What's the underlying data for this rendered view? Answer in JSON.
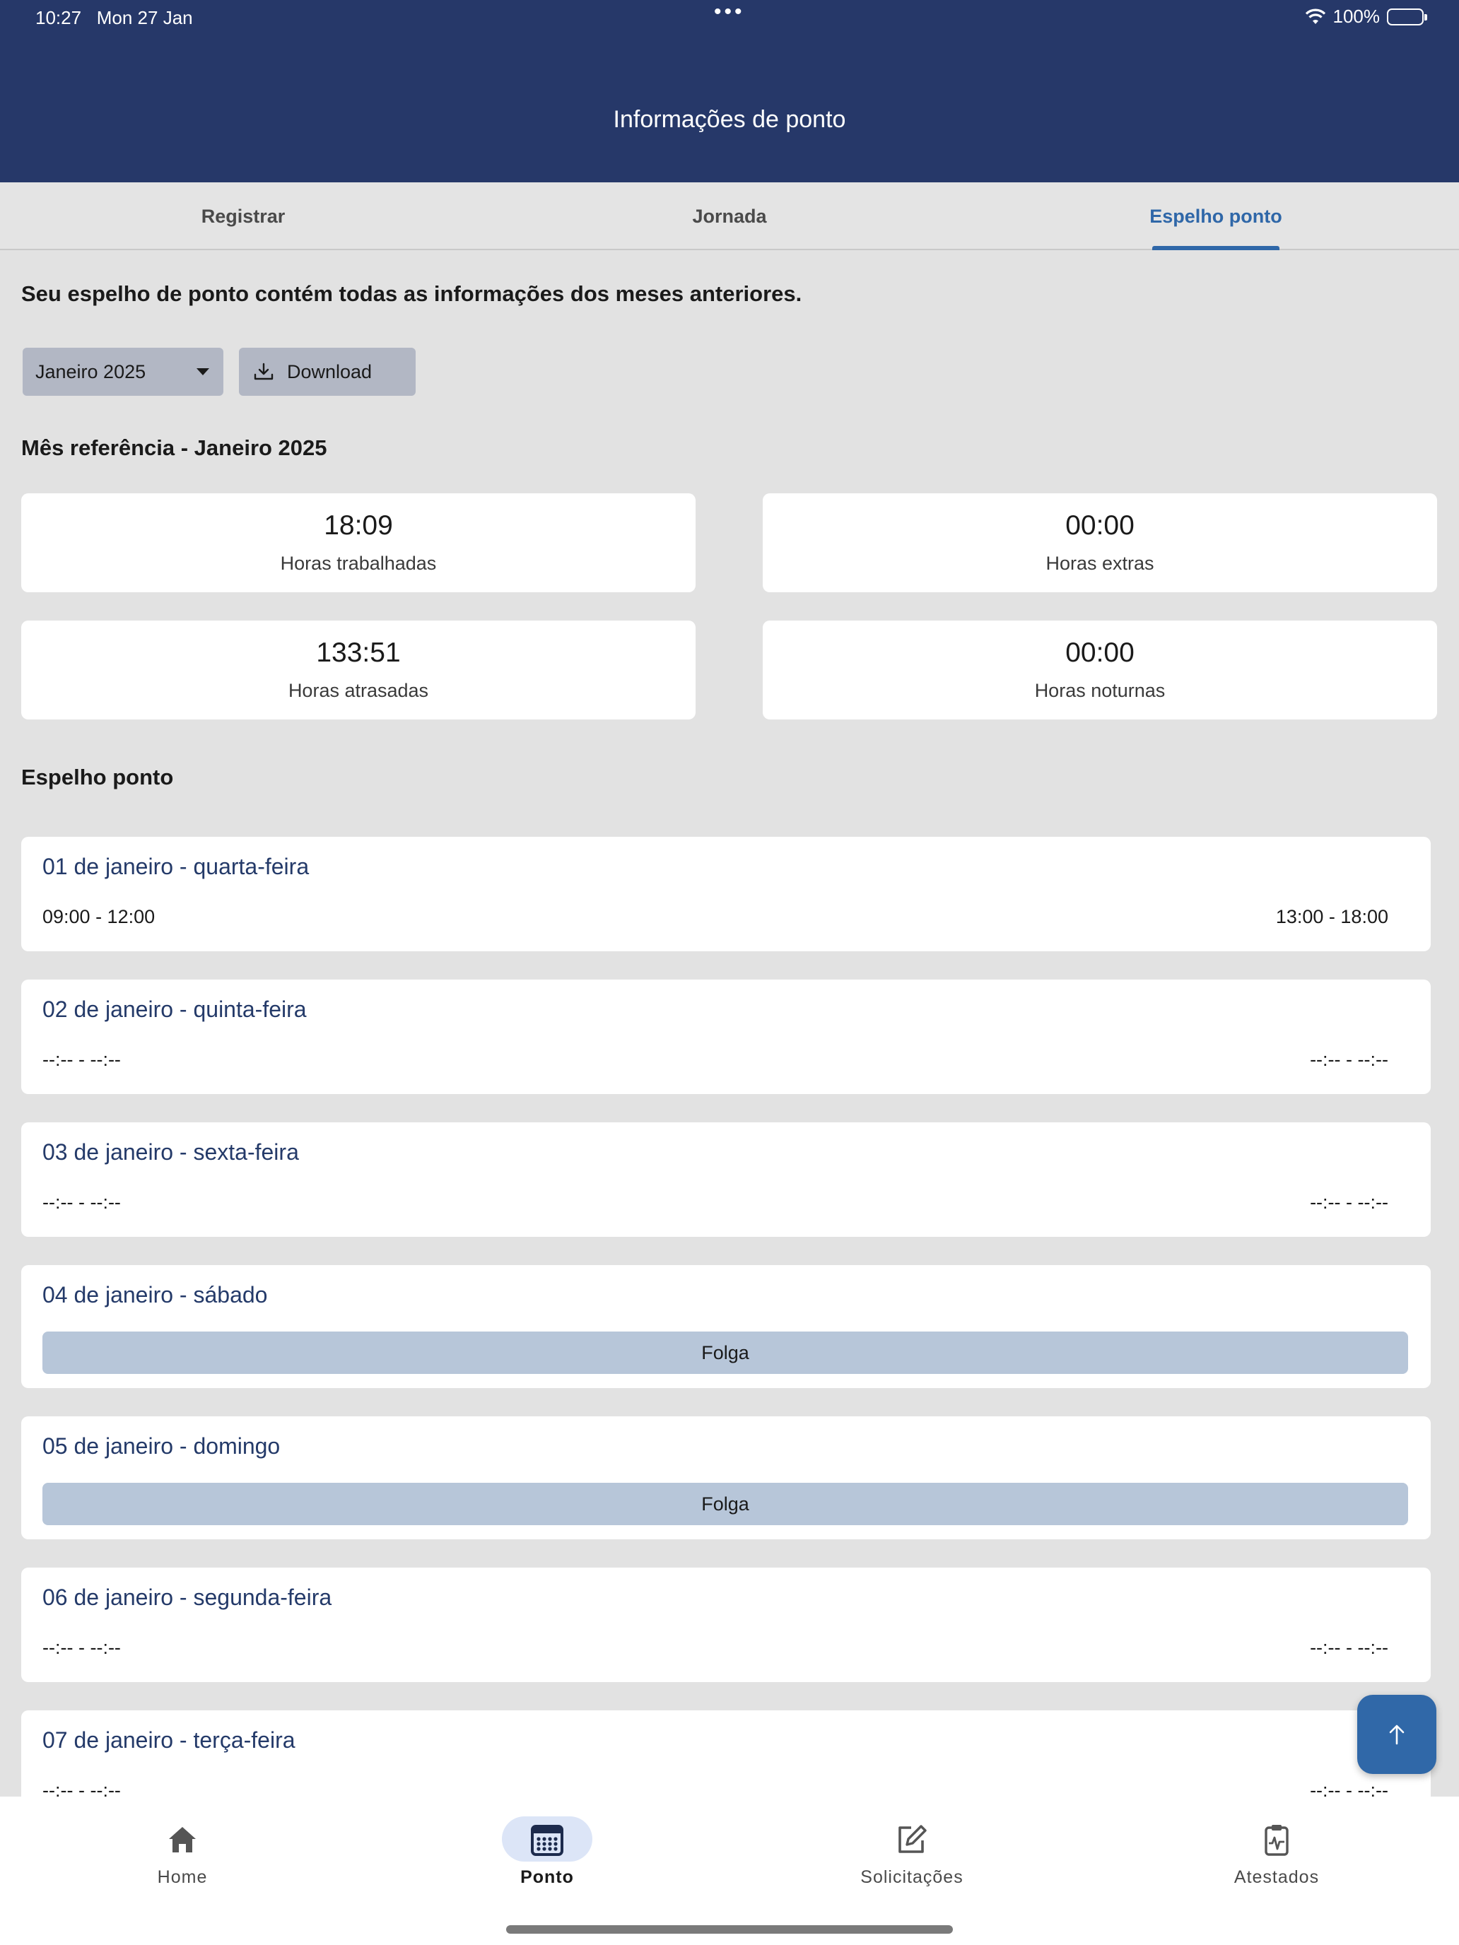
{
  "status_bar": {
    "time": "10:27",
    "date": "Mon 27 Jan",
    "dots": "•••",
    "battery": "100%"
  },
  "header": {
    "title": "Informações de ponto"
  },
  "tabs": [
    {
      "label": "Registrar"
    },
    {
      "label": "Jornada"
    },
    {
      "label": "Espelho ponto"
    }
  ],
  "intro": "Seu espelho de ponto contém todas as informações dos meses anteriores.",
  "controls": {
    "month": "Janeiro 2025",
    "download": "Download"
  },
  "reference": {
    "title": "Mês referência - Janeiro 2025"
  },
  "stats": [
    {
      "value": "18:09",
      "label": "Horas trabalhadas"
    },
    {
      "value": "00:00",
      "label": "Horas extras"
    },
    {
      "value": "133:51",
      "label": "Horas atrasadas"
    },
    {
      "value": "00:00",
      "label": "Horas noturnas"
    }
  ],
  "section_title": "Espelho ponto",
  "days": [
    {
      "date": "01 de janeiro - quarta-feira",
      "left": "09:00 - 12:00",
      "right": "13:00 - 18:00"
    },
    {
      "date": "02 de janeiro - quinta-feira",
      "left": "--:-- - --:--",
      "right": "--:-- - --:--"
    },
    {
      "date": "03 de janeiro - sexta-feira",
      "left": "--:-- - --:--",
      "right": "--:-- - --:--"
    },
    {
      "date": "04 de janeiro - sábado",
      "status": "Folga"
    },
    {
      "date": "05 de janeiro - domingo",
      "status": "Folga"
    },
    {
      "date": "06 de janeiro - segunda-feira",
      "left": "--:-- - --:--",
      "right": "--:-- - --:--"
    },
    {
      "date": "07 de janeiro - terça-feira",
      "left": "--:-- - --:--",
      "right": "--:-- - --:--"
    }
  ],
  "bottom_nav": [
    {
      "label": "Home",
      "icon": "home-icon"
    },
    {
      "label": "Ponto",
      "icon": "calendar-icon"
    },
    {
      "label": "Solicitações",
      "icon": "edit-icon"
    },
    {
      "label": "Atestados",
      "icon": "medical-clipboard-icon"
    }
  ]
}
